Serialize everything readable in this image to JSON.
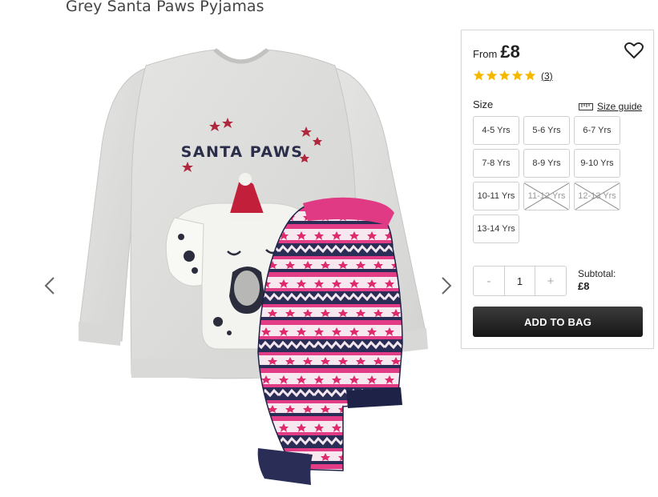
{
  "product": {
    "title": "Grey Santa Paws Pyjamas",
    "graphic_text": "SANTA PAWS"
  },
  "gallery": {
    "prev_icon": "chevron-left-icon",
    "next_icon": "chevron-right-icon"
  },
  "purchase": {
    "price_prefix": "From",
    "price": "£8",
    "wishlist_icon": "heart-icon",
    "rating": {
      "stars": 5,
      "max": 5,
      "review_count": "(3)",
      "star_color": "#f5b800"
    },
    "size_label": "Size",
    "size_guide_label": "Size guide",
    "size_guide_icon": "ruler-icon",
    "sizes": [
      {
        "label": "4-5 Yrs",
        "available": true
      },
      {
        "label": "5-6 Yrs",
        "available": true
      },
      {
        "label": "6-7 Yrs",
        "available": true
      },
      {
        "label": "7-8 Yrs",
        "available": true
      },
      {
        "label": "8-9 Yrs",
        "available": true
      },
      {
        "label": "9-10 Yrs",
        "available": true
      },
      {
        "label": "10-11 Yrs",
        "available": true
      },
      {
        "label": "11-12 Yrs",
        "available": false
      },
      {
        "label": "12-13 Yrs",
        "available": false
      },
      {
        "label": "13-14 Yrs",
        "available": true
      }
    ],
    "quantity": {
      "minus": "-",
      "value": "1",
      "plus": "+"
    },
    "subtotal_label": "Subtotal:",
    "subtotal_value": "£8",
    "add_to_bag_label": "ADD TO BAG",
    "button_color": "#222222"
  }
}
